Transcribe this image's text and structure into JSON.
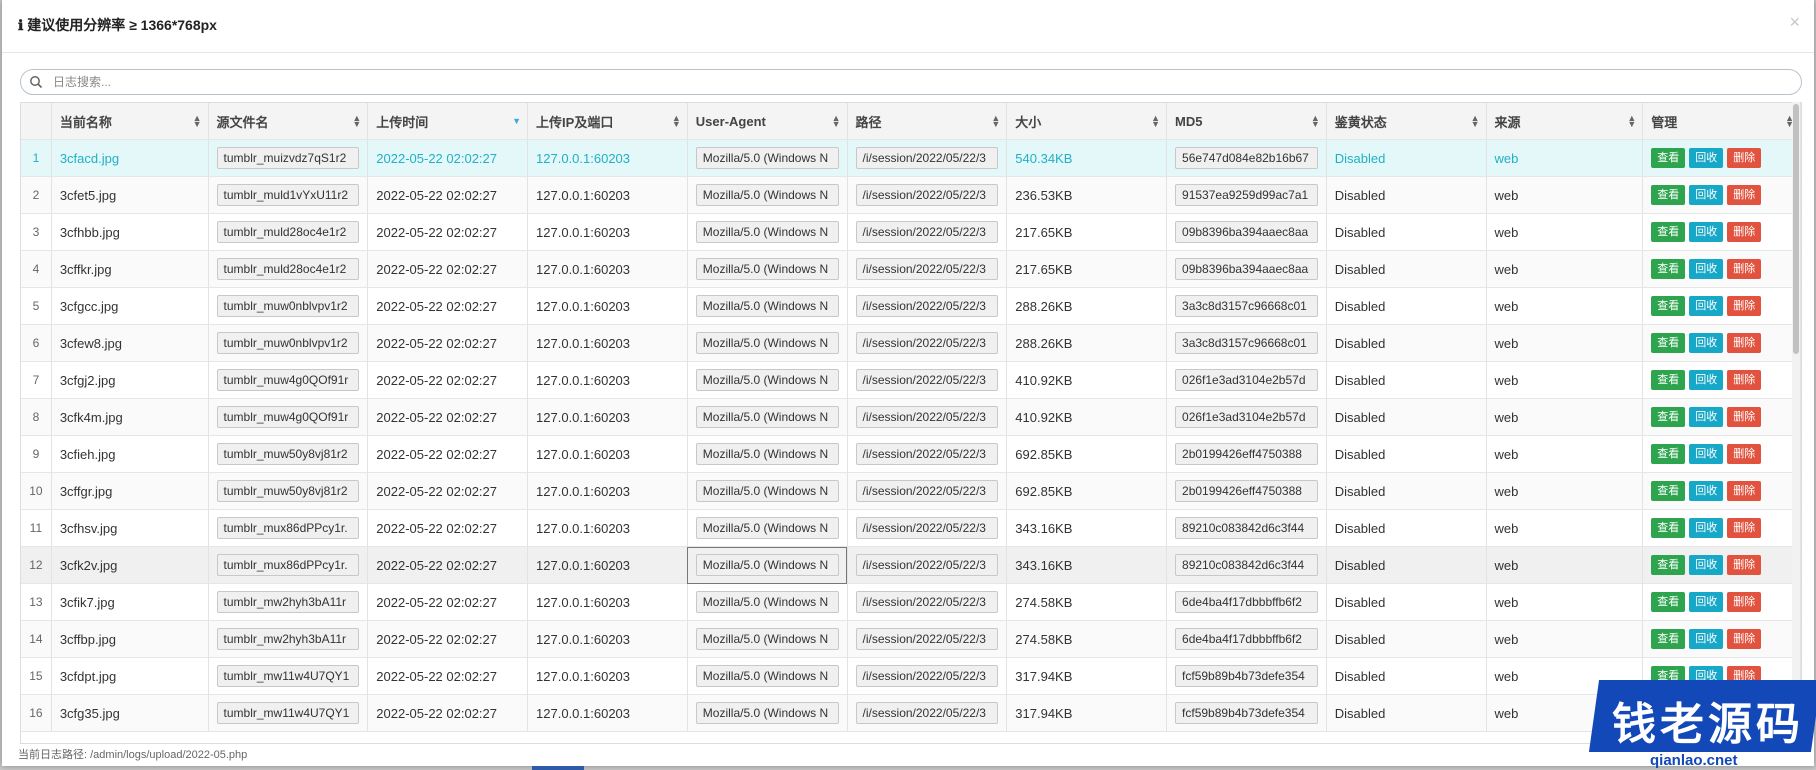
{
  "header": {
    "title": "ℹ 建议使用分辨率 ≥ 1366*768px",
    "close": "×"
  },
  "search": {
    "placeholder": "日志搜索..."
  },
  "columns": [
    "当前名称",
    "源文件名",
    "上传时间",
    "上传IP及端口",
    "User-Agent",
    "路径",
    "大小",
    "MD5",
    "鉴黄状态",
    "来源",
    "管理"
  ],
  "actions": {
    "view": "查看",
    "recycle": "回收",
    "delete": "删除"
  },
  "rows": [
    {
      "n": "1",
      "name": "3cfacd.jpg",
      "src": "tumblr_muizvdz7qS1r2",
      "time": "2022-05-22 02:02:27",
      "ip": "127.0.0.1:60203",
      "ua": "Mozilla/5.0 (Windows N",
      "path": "/i/session/2022/05/22/3",
      "size": "540.34KB",
      "md5": "56e747d084e82b16b67",
      "status": "Disabled",
      "source": "web"
    },
    {
      "n": "2",
      "name": "3cfet5.jpg",
      "src": "tumblr_muld1vYxU11r2",
      "time": "2022-05-22 02:02:27",
      "ip": "127.0.0.1:60203",
      "ua": "Mozilla/5.0 (Windows N",
      "path": "/i/session/2022/05/22/3",
      "size": "236.53KB",
      "md5": "91537ea9259d99ac7a1",
      "status": "Disabled",
      "source": "web"
    },
    {
      "n": "3",
      "name": "3cfhbb.jpg",
      "src": "tumblr_muld28oc4e1r2",
      "time": "2022-05-22 02:02:27",
      "ip": "127.0.0.1:60203",
      "ua": "Mozilla/5.0 (Windows N",
      "path": "/i/session/2022/05/22/3",
      "size": "217.65KB",
      "md5": "09b8396ba394aaec8aa",
      "status": "Disabled",
      "source": "web"
    },
    {
      "n": "4",
      "name": "3cffkr.jpg",
      "src": "tumblr_muld28oc4e1r2",
      "time": "2022-05-22 02:02:27",
      "ip": "127.0.0.1:60203",
      "ua": "Mozilla/5.0 (Windows N",
      "path": "/i/session/2022/05/22/3",
      "size": "217.65KB",
      "md5": "09b8396ba394aaec8aa",
      "status": "Disabled",
      "source": "web"
    },
    {
      "n": "5",
      "name": "3cfgcc.jpg",
      "src": "tumblr_muw0nblvpv1r2",
      "time": "2022-05-22 02:02:27",
      "ip": "127.0.0.1:60203",
      "ua": "Mozilla/5.0 (Windows N",
      "path": "/i/session/2022/05/22/3",
      "size": "288.26KB",
      "md5": "3a3c8d3157c96668c01",
      "status": "Disabled",
      "source": "web"
    },
    {
      "n": "6",
      "name": "3cfew8.jpg",
      "src": "tumblr_muw0nblvpv1r2",
      "time": "2022-05-22 02:02:27",
      "ip": "127.0.0.1:60203",
      "ua": "Mozilla/5.0 (Windows N",
      "path": "/i/session/2022/05/22/3",
      "size": "288.26KB",
      "md5": "3a3c8d3157c96668c01",
      "status": "Disabled",
      "source": "web"
    },
    {
      "n": "7",
      "name": "3cfgj2.jpg",
      "src": "tumblr_muw4g0QOf91r",
      "time": "2022-05-22 02:02:27",
      "ip": "127.0.0.1:60203",
      "ua": "Mozilla/5.0 (Windows N",
      "path": "/i/session/2022/05/22/3",
      "size": "410.92KB",
      "md5": "026f1e3ad3104e2b57d",
      "status": "Disabled",
      "source": "web"
    },
    {
      "n": "8",
      "name": "3cfk4m.jpg",
      "src": "tumblr_muw4g0QOf91r",
      "time": "2022-05-22 02:02:27",
      "ip": "127.0.0.1:60203",
      "ua": "Mozilla/5.0 (Windows N",
      "path": "/i/session/2022/05/22/3",
      "size": "410.92KB",
      "md5": "026f1e3ad3104e2b57d",
      "status": "Disabled",
      "source": "web"
    },
    {
      "n": "9",
      "name": "3cfieh.jpg",
      "src": "tumblr_muw50y8vj81r2",
      "time": "2022-05-22 02:02:27",
      "ip": "127.0.0.1:60203",
      "ua": "Mozilla/5.0 (Windows N",
      "path": "/i/session/2022/05/22/3",
      "size": "692.85KB",
      "md5": "2b0199426eff4750388",
      "status": "Disabled",
      "source": "web"
    },
    {
      "n": "10",
      "name": "3cffgr.jpg",
      "src": "tumblr_muw50y8vj81r2",
      "time": "2022-05-22 02:02:27",
      "ip": "127.0.0.1:60203",
      "ua": "Mozilla/5.0 (Windows N",
      "path": "/i/session/2022/05/22/3",
      "size": "692.85KB",
      "md5": "2b0199426eff4750388",
      "status": "Disabled",
      "source": "web"
    },
    {
      "n": "11",
      "name": "3cfhsv.jpg",
      "src": "tumblr_mux86dPPcy1r.",
      "time": "2022-05-22 02:02:27",
      "ip": "127.0.0.1:60203",
      "ua": "Mozilla/5.0 (Windows N",
      "path": "/i/session/2022/05/22/3",
      "size": "343.16KB",
      "md5": "89210c083842d6c3f44",
      "status": "Disabled",
      "source": "web"
    },
    {
      "n": "12",
      "name": "3cfk2v.jpg",
      "src": "tumblr_mux86dPPcy1r.",
      "time": "2022-05-22 02:02:27",
      "ip": "127.0.0.1:60203",
      "ua": "Mozilla/5.0 (Windows N",
      "path": "/i/session/2022/05/22/3",
      "size": "343.16KB",
      "md5": "89210c083842d6c3f44",
      "status": "Disabled",
      "source": "web"
    },
    {
      "n": "13",
      "name": "3cfik7.jpg",
      "src": "tumblr_mw2hyh3bA11r",
      "time": "2022-05-22 02:02:27",
      "ip": "127.0.0.1:60203",
      "ua": "Mozilla/5.0 (Windows N",
      "path": "/i/session/2022/05/22/3",
      "size": "274.58KB",
      "md5": "6de4ba4f17dbbbffb6f2",
      "status": "Disabled",
      "source": "web"
    },
    {
      "n": "14",
      "name": "3cffbp.jpg",
      "src": "tumblr_mw2hyh3bA11r",
      "time": "2022-05-22 02:02:27",
      "ip": "127.0.0.1:60203",
      "ua": "Mozilla/5.0 (Windows N",
      "path": "/i/session/2022/05/22/3",
      "size": "274.58KB",
      "md5": "6de4ba4f17dbbbffb6f2",
      "status": "Disabled",
      "source": "web"
    },
    {
      "n": "15",
      "name": "3cfdpt.jpg",
      "src": "tumblr_mw11w4U7QY1",
      "time": "2022-05-22 02:02:27",
      "ip": "127.0.0.1:60203",
      "ua": "Mozilla/5.0 (Windows N",
      "path": "/i/session/2022/05/22/3",
      "size": "317.94KB",
      "md5": "fcf59b89b4b73defe354",
      "status": "Disabled",
      "source": "web"
    },
    {
      "n": "16",
      "name": "3cfg35.jpg",
      "src": "tumblr_mw11w4U7QY1",
      "time": "2022-05-22 02:02:27",
      "ip": "127.0.0.1:60203",
      "ua": "Mozilla/5.0 (Windows N",
      "path": "/i/session/2022/05/22/3",
      "size": "317.94KB",
      "md5": "fcf59b89b4b73defe354",
      "status": "Disabled",
      "source": "web"
    }
  ],
  "footer": {
    "label": "当前日志路径: /admin/logs/upload/2022-05.php"
  },
  "watermark": {
    "text": "钱老源码",
    "sub": "qianlao.cnet"
  },
  "colors": {
    "selected_text": "#1fb2c5",
    "view": "#2ea44f",
    "recycle": "#17a8c8",
    "delete": "#e2533f"
  }
}
